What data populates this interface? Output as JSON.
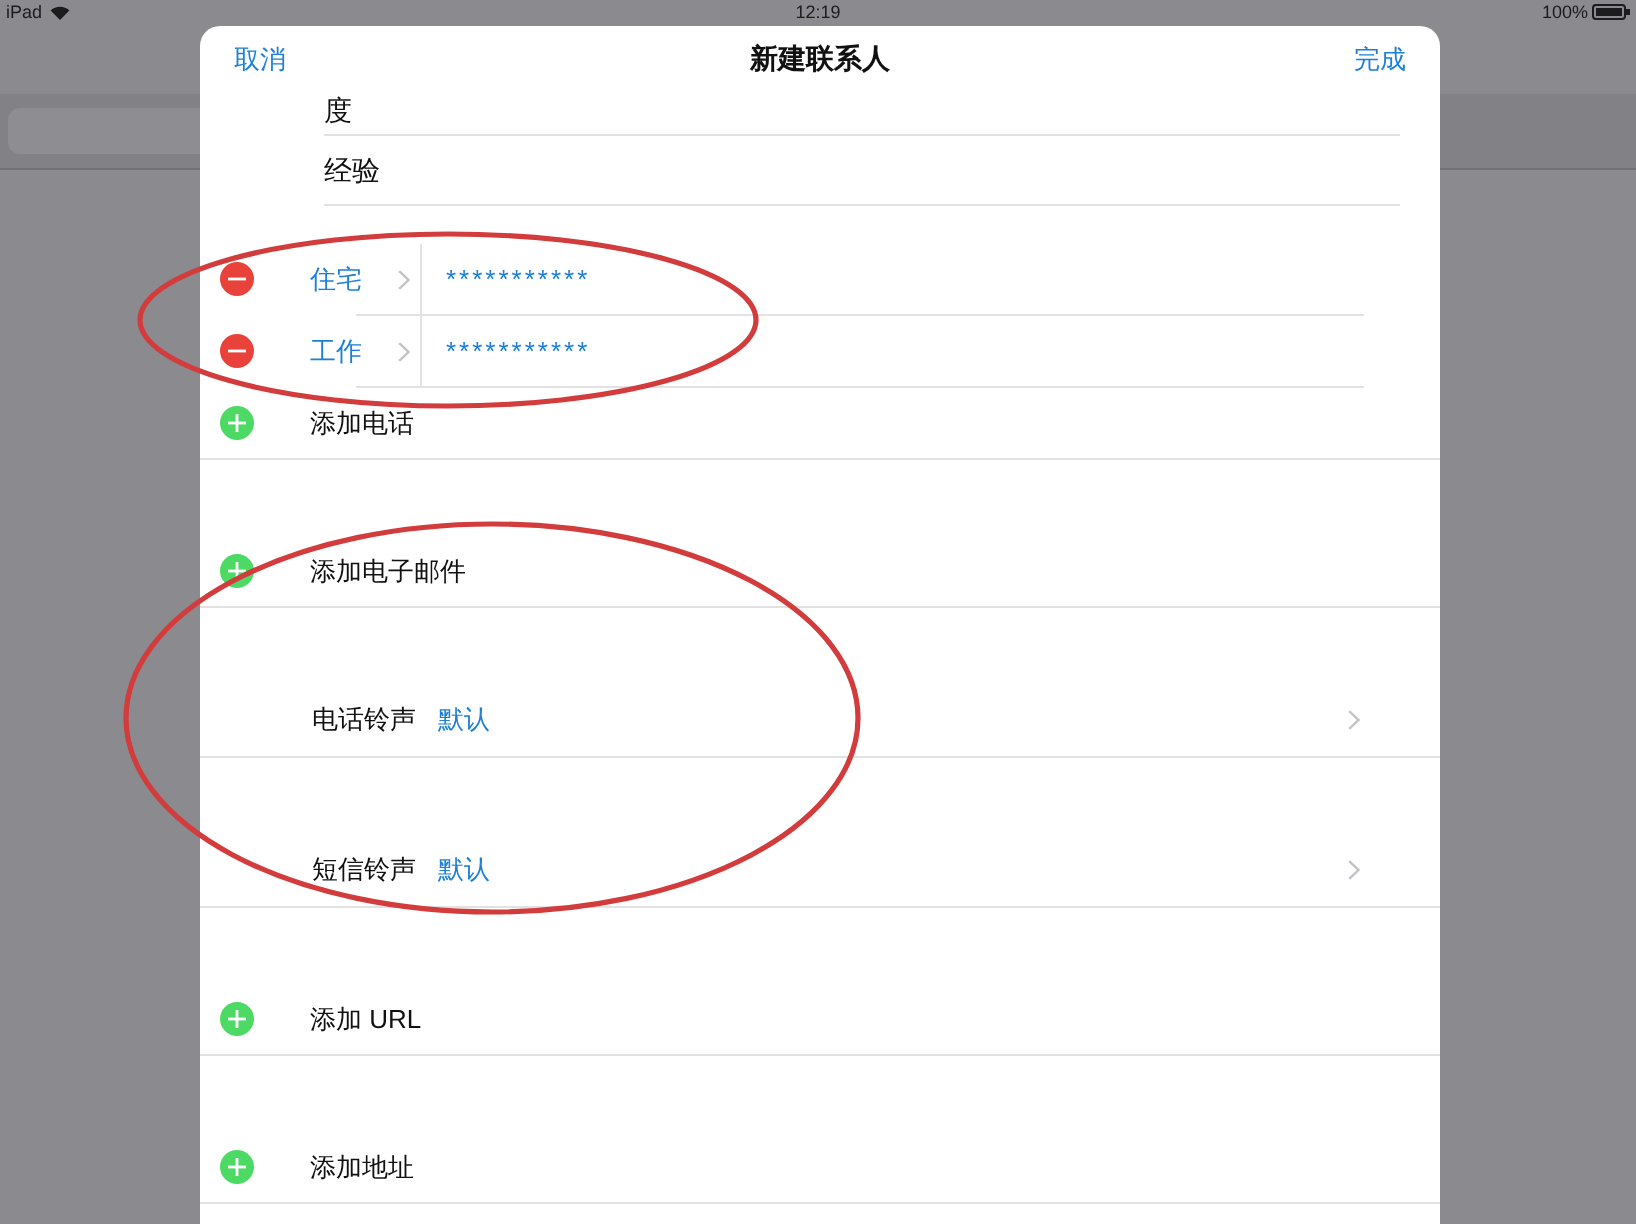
{
  "status_bar": {
    "device": "iPad",
    "time": "12:19",
    "battery": "100%"
  },
  "sheet": {
    "cancel": "取消",
    "title": "新建联系人",
    "done": "完成"
  },
  "fields": [
    {
      "value": "度"
    },
    {
      "value": "经验"
    }
  ],
  "sections": [
    {
      "rows": [
        {
          "kind": "phone",
          "label": "住宅",
          "value": "***********"
        },
        {
          "kind": "phone",
          "label": "工作",
          "value": "***********"
        },
        {
          "kind": "add",
          "label": "添加电话"
        }
      ]
    },
    {
      "rows": [
        {
          "kind": "add",
          "label": "添加电子邮件"
        }
      ]
    },
    {
      "rows": [
        {
          "kind": "setting",
          "label": "电话铃声",
          "value": "默认"
        }
      ]
    },
    {
      "rows": [
        {
          "kind": "setting",
          "label": "短信铃声",
          "value": "默认"
        }
      ]
    },
    {
      "rows": [
        {
          "kind": "add",
          "label": "添加 URL"
        }
      ]
    },
    {
      "rows": [
        {
          "kind": "add",
          "label": "添加地址"
        }
      ]
    }
  ],
  "annotations": [
    {
      "kind": "ellipse"
    },
    {
      "kind": "ellipse"
    }
  ]
}
